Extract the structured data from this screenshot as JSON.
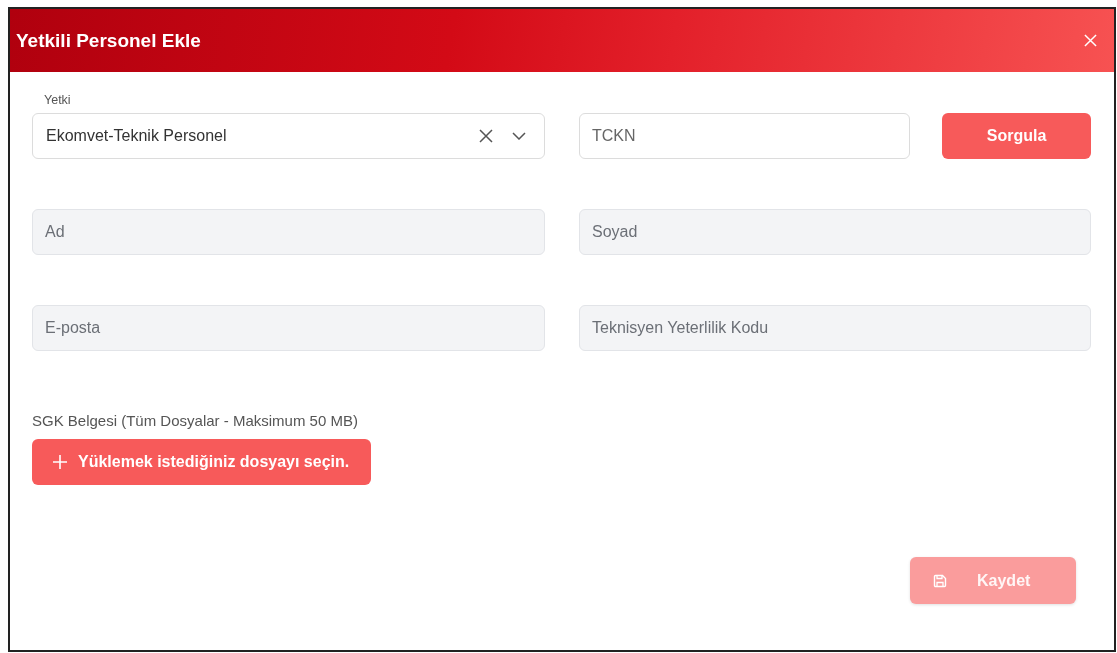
{
  "dialog": {
    "title": "Yetkili Personel Ekle"
  },
  "yetki": {
    "label": "Yetki",
    "value": "Ekomvet-Teknik Personel"
  },
  "tckn": {
    "placeholder": "TCKN",
    "disabled": false
  },
  "query_button": {
    "label": "Sorgula"
  },
  "fields": [
    {
      "placeholder": "Ad",
      "disabled": true
    },
    {
      "placeholder": "Soyad",
      "disabled": true
    },
    {
      "placeholder": "E-posta",
      "disabled": true
    },
    {
      "placeholder": "Teknisyen Yeterlilik Kodu",
      "disabled": true
    }
  ],
  "upload": {
    "label": "SGK Belgesi (Tüm Dosyalar - Maksimum 50 MB)",
    "button": "Yüklemek istediğiniz dosyayı seçin."
  },
  "save_button": {
    "label": "Kaydet",
    "disabled": true
  }
}
